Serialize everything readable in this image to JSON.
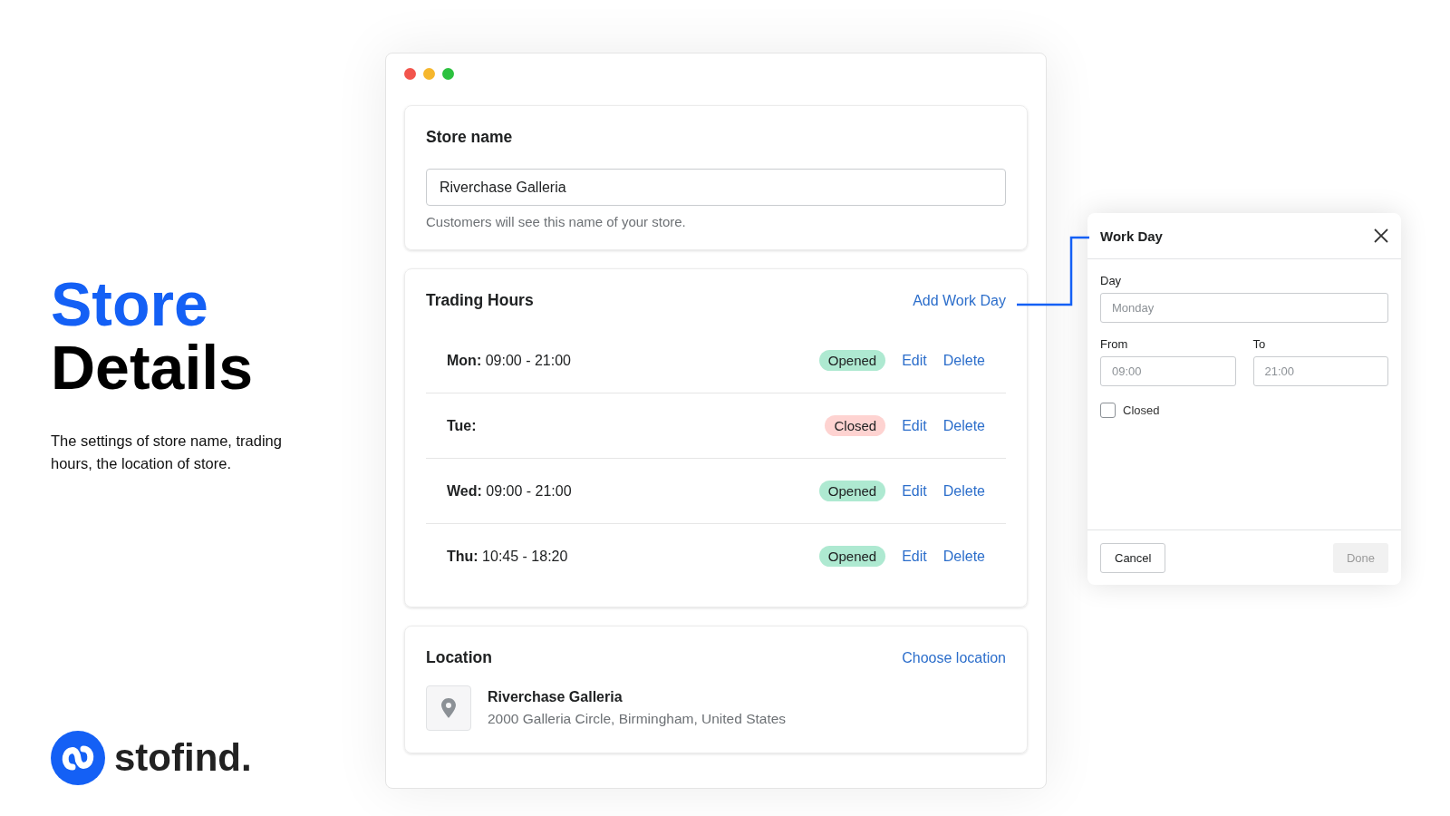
{
  "hero": {
    "title_line_1": "Store",
    "title_line_2": "Details",
    "description": "The settings of store name, trading hours, the location of store.",
    "brand": "stofind."
  },
  "window": {
    "store_name": {
      "title": "Store name",
      "value": "Riverchase Galleria",
      "help": "Customers will see this name of your store."
    },
    "trading_hours": {
      "title": "Trading Hours",
      "action": "Add Work Day",
      "rows": [
        {
          "day": "Mon:",
          "hours": "09:00 - 21:00",
          "kind": "opened",
          "badge": "Opened",
          "edit": "Edit",
          "delete": "Delete"
        },
        {
          "day": "Tue:",
          "kind": "closed",
          "badge": "Closed",
          "edit": "Edit",
          "delete": "Delete"
        },
        {
          "day": "Wed:",
          "hours": "09:00 - 21:00",
          "kind": "opened",
          "badge": "Opened",
          "edit": "Edit",
          "delete": "Delete"
        },
        {
          "day": "Thu:",
          "hours": "10:45 - 18:20",
          "kind": "opened",
          "badge": "Opened",
          "edit": "Edit",
          "delete": "Delete"
        }
      ]
    },
    "location": {
      "title": "Location",
      "action": "Choose location",
      "name": "Riverchase Galleria",
      "address": "2000 Galleria Circle, Birmingham, United States"
    }
  },
  "dialog": {
    "title": "Work Day",
    "day_label": "Day",
    "day_placeholder": "Monday",
    "from_label": "From",
    "from_placeholder": "09:00",
    "to_label": "To",
    "to_placeholder": "21:00",
    "closed_label": "Closed",
    "closed_checked": false,
    "cancel": "Cancel",
    "done": "Done",
    "done_disabled": true
  }
}
